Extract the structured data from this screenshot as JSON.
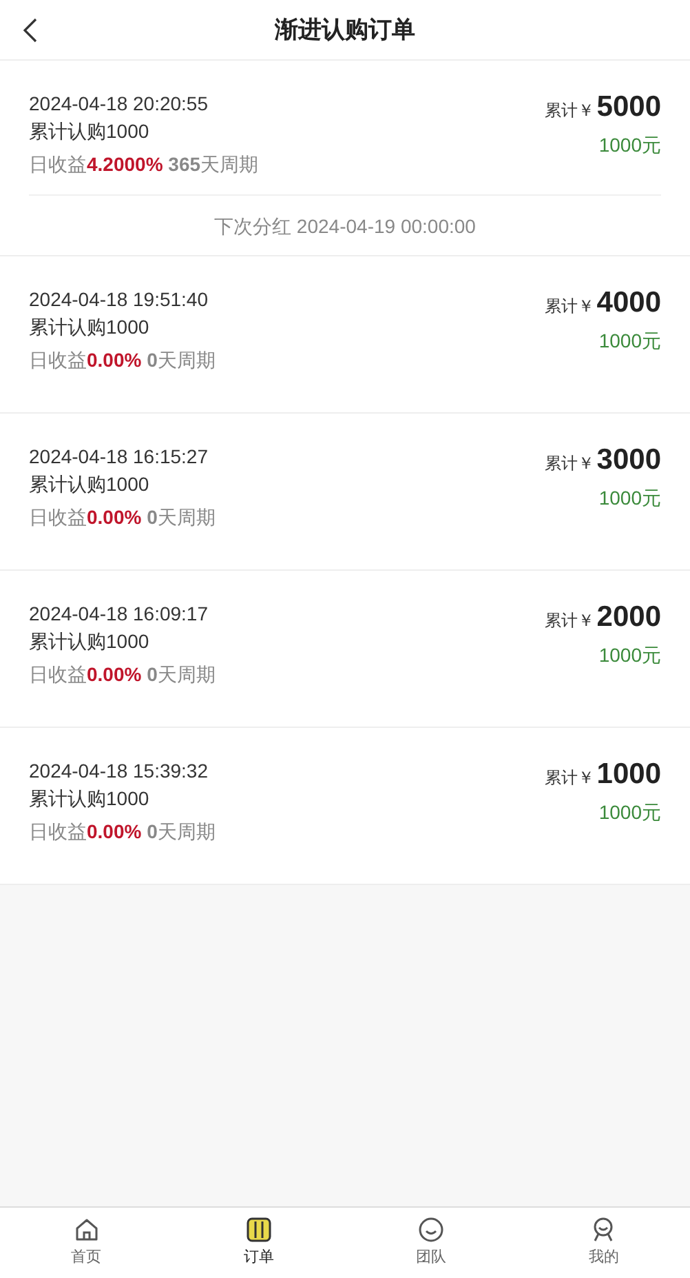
{
  "header": {
    "title": "渐进认购订单"
  },
  "orders": [
    {
      "time": "2024-04-18 20:20:55",
      "subscribed": "累计认购1000",
      "rate_label": "日收益",
      "rate": "4.2000%",
      "cycle": "365",
      "cycle_unit": "天周期",
      "total_label": "累计￥",
      "total": "5000",
      "paid": "1000元",
      "next_dividend": "下次分红 2024-04-19 00:00:00"
    },
    {
      "time": "2024-04-18 19:51:40",
      "subscribed": "累计认购1000",
      "rate_label": "日收益",
      "rate": "0.00%",
      "cycle": "0",
      "cycle_unit": "天周期",
      "total_label": "累计￥",
      "total": "4000",
      "paid": "1000元"
    },
    {
      "time": "2024-04-18 16:15:27",
      "subscribed": "累计认购1000",
      "rate_label": "日收益",
      "rate": "0.00%",
      "cycle": "0",
      "cycle_unit": "天周期",
      "total_label": "累计￥",
      "total": "3000",
      "paid": "1000元"
    },
    {
      "time": "2024-04-18 16:09:17",
      "subscribed": "累计认购1000",
      "rate_label": "日收益",
      "rate": "0.00%",
      "cycle": "0",
      "cycle_unit": "天周期",
      "total_label": "累计￥",
      "total": "2000",
      "paid": "1000元"
    },
    {
      "time": "2024-04-18 15:39:32",
      "subscribed": "累计认购1000",
      "rate_label": "日收益",
      "rate": "0.00%",
      "cycle": "0",
      "cycle_unit": "天周期",
      "total_label": "累计￥",
      "total": "1000",
      "paid": "1000元"
    }
  ],
  "nav": [
    {
      "kind": "home",
      "label": "首页",
      "selected": false
    },
    {
      "kind": "orders",
      "label": "订单",
      "selected": true
    },
    {
      "kind": "team",
      "label": "团队",
      "selected": false
    },
    {
      "kind": "me",
      "label": "我的",
      "selected": false
    }
  ]
}
